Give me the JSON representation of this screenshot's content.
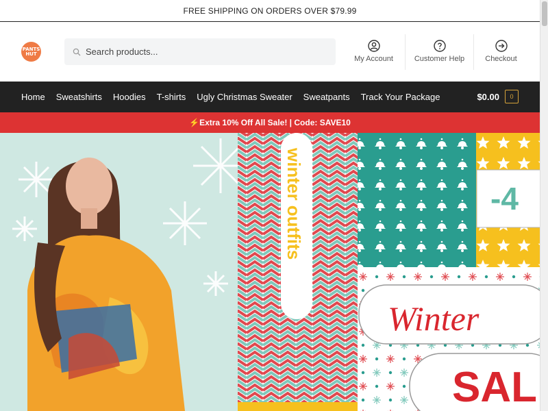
{
  "topbar": {
    "text": "FREE SHIPPING ON ORDERS OVER $79.99"
  },
  "header": {
    "logo_text": "PANTS HUT",
    "search": {
      "placeholder": "Search products..."
    },
    "links": [
      {
        "label": "My Account",
        "icon": "user-icon"
      },
      {
        "label": "Customer Help",
        "icon": "help-icon"
      },
      {
        "label": "Checkout",
        "icon": "arrow-right-circle-icon"
      }
    ]
  },
  "nav": {
    "items": [
      "Home",
      "Sweatshirts",
      "Hoodies",
      "T-shirts",
      "Ugly Christmas Sweater",
      "Sweatpants",
      "Track Your Package"
    ],
    "cart_total": "$0.00",
    "cart_count": "0"
  },
  "promo": {
    "text": "⚡Extra 10% Off All Sale! | Code: SAVE10"
  },
  "hero": {
    "vertical_text": "winter outfits",
    "discount_text": "-4",
    "script_text": "Winter",
    "sale_text": "SALE",
    "colors": {
      "mint": "#cfe8e2",
      "teal": "#2a9d8f",
      "red": "#e0494f",
      "yellow": "#f6c01e",
      "coral": "#ef7b45"
    }
  }
}
